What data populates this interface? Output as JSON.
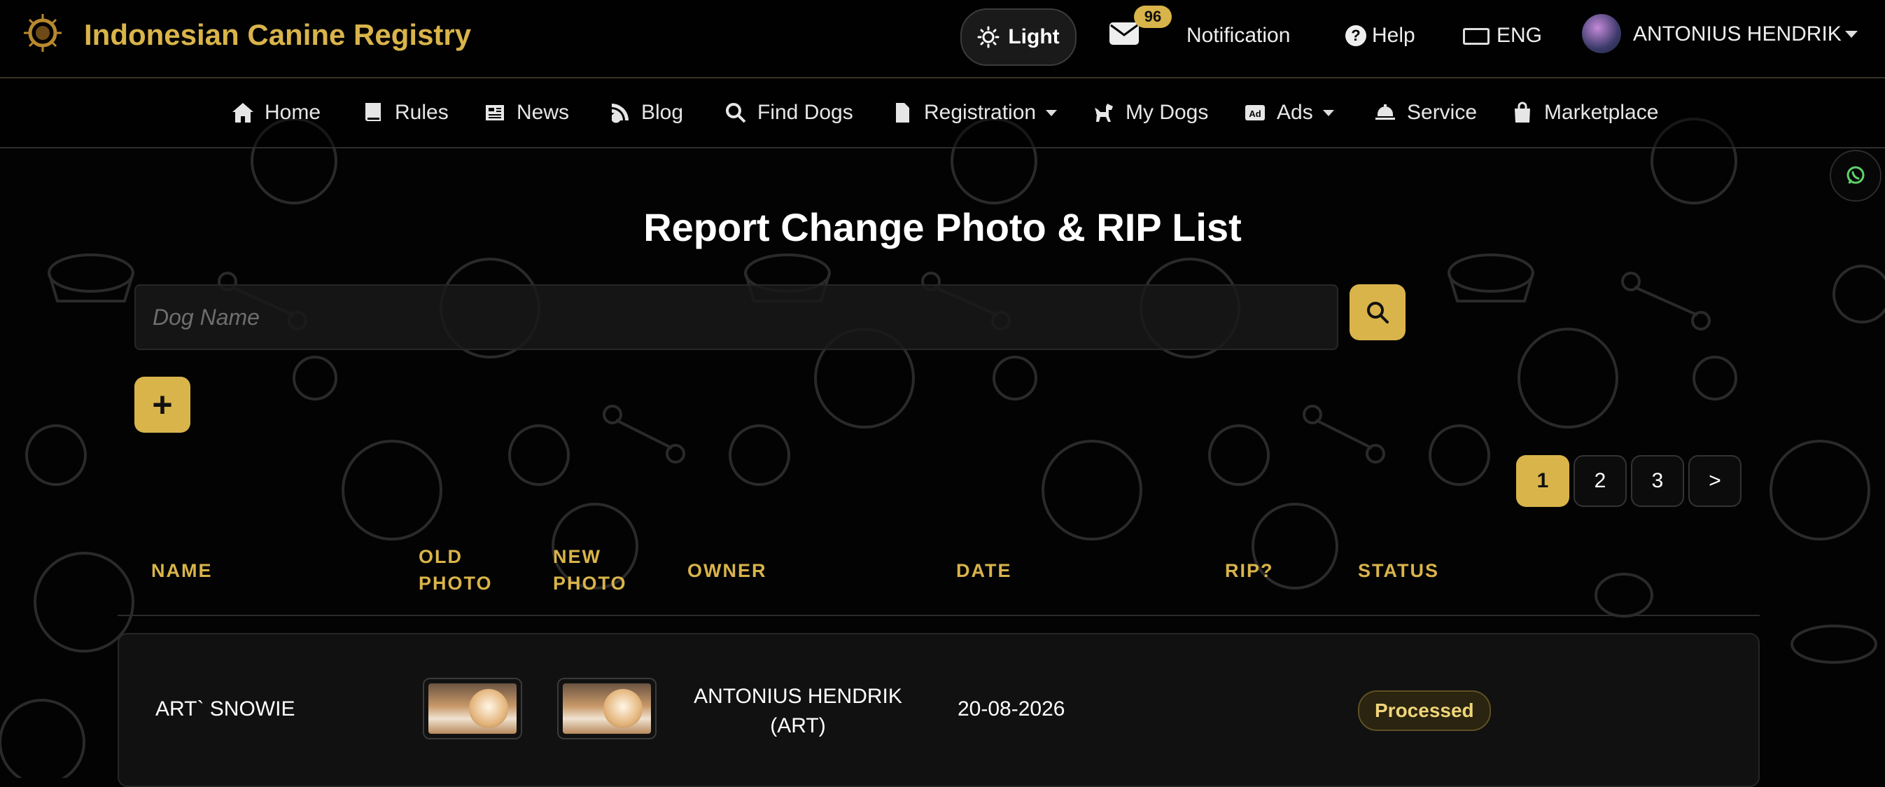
{
  "header": {
    "brand": "Indonesian Canine Registry",
    "theme_label": "Light",
    "mail_count": "96",
    "notification_label": "Notification",
    "help_label": "Help",
    "language": "ENG",
    "user_name": "ANTONIUS HENDRIK"
  },
  "nav": {
    "items": [
      {
        "label": "Home",
        "icon": "home-icon"
      },
      {
        "label": "Rules",
        "icon": "book-icon"
      },
      {
        "label": "News",
        "icon": "newspaper-icon"
      },
      {
        "label": "Blog",
        "icon": "blog-icon"
      },
      {
        "label": "Find Dogs",
        "icon": "search-icon"
      },
      {
        "label": "Registration",
        "icon": "file-icon"
      },
      {
        "label": "My Dogs",
        "icon": "dog-icon"
      },
      {
        "label": "Ads",
        "icon": "ad-icon"
      },
      {
        "label": "Service",
        "icon": "bell-icon"
      },
      {
        "label": "Marketplace",
        "icon": "bag-icon"
      }
    ]
  },
  "page": {
    "title": "Report Change Photo & RIP List",
    "search_placeholder": "Dog Name",
    "add_label": "+"
  },
  "pagination": {
    "pages": [
      "1",
      "2",
      "3"
    ],
    "next_label": ">",
    "current": "1"
  },
  "table": {
    "headers": {
      "name": "NAME",
      "old_photo_1": "OLD",
      "old_photo_2": "PHOTO",
      "new_photo_1": "NEW",
      "new_photo_2": "PHOTO",
      "owner": "OWNER",
      "date": "DATE",
      "rip": "RIP?",
      "status": "STATUS"
    },
    "rows": [
      {
        "name": "ART` SNOWIE",
        "owner_line1": "ANTONIUS HENDRIK",
        "owner_line2": "(ART)",
        "date": "20-08-2026",
        "rip": "",
        "status": "Processed"
      }
    ]
  },
  "colors": {
    "accent": "#d9b44a",
    "background": "#030303"
  }
}
